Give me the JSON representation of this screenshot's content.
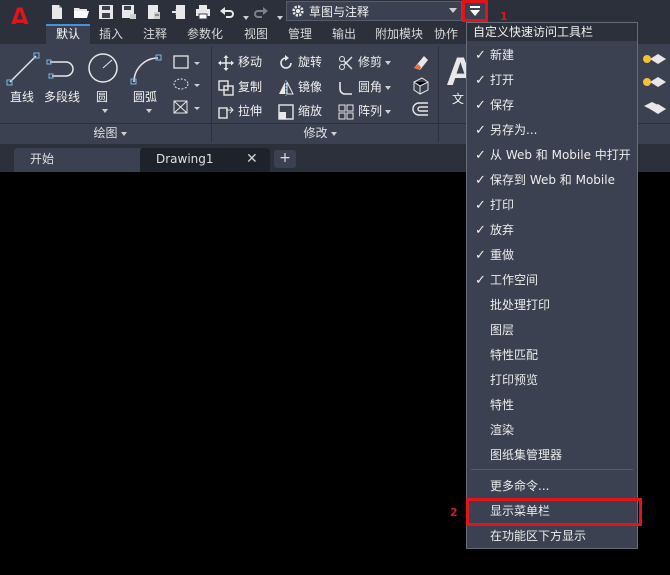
{
  "app": {
    "logo_letter": "A",
    "brand_color": "#e0151b"
  },
  "quick_access": {
    "icons": [
      "new-icon",
      "open-icon",
      "save-icon",
      "save-as-icon",
      "open-web-icon",
      "save-web-icon",
      "print-icon",
      "undo-icon",
      "redo-icon"
    ],
    "workspace": {
      "label": "草图与注释"
    }
  },
  "ribbon_tabs": [
    "默认",
    "插入",
    "注释",
    "参数化",
    "视图",
    "管理",
    "输出",
    "附加模块",
    "协作"
  ],
  "draw_panel": {
    "tools": [
      "直线",
      "多段线",
      "圆",
      "圆弧"
    ],
    "title": "绘图"
  },
  "modify_panel": {
    "rows": [
      [
        "移动",
        "旋转",
        "修剪"
      ],
      [
        "复制",
        "镜像",
        "圆角"
      ],
      [
        "拉伸",
        "缩放",
        "阵列"
      ]
    ],
    "title": "修改"
  },
  "annotation_partial": {
    "big_letter": "A",
    "label": "文"
  },
  "doc_tabs": [
    "开始",
    "Drawing1"
  ],
  "doc_tab_add": "+",
  "callouts": {
    "one": "1",
    "two": "2"
  },
  "menu": {
    "header": "自定义快速访问工具栏",
    "items": [
      {
        "label": "新建",
        "checked": true
      },
      {
        "label": "打开",
        "checked": true
      },
      {
        "label": "保存",
        "checked": true
      },
      {
        "label": "另存为...",
        "checked": true
      },
      {
        "label": "从 Web 和 Mobile 中打开",
        "checked": true
      },
      {
        "label": "保存到 Web 和 Mobile",
        "checked": true
      },
      {
        "label": "打印",
        "checked": true
      },
      {
        "label": "放弃",
        "checked": true
      },
      {
        "label": "重做",
        "checked": true
      },
      {
        "label": "工作空间",
        "checked": true
      },
      {
        "label": "批处理打印",
        "checked": false
      },
      {
        "label": "图层",
        "checked": false
      },
      {
        "label": "特性匹配",
        "checked": false
      },
      {
        "label": "打印预览",
        "checked": false
      },
      {
        "label": "特性",
        "checked": false
      },
      {
        "label": "渲染",
        "checked": false
      },
      {
        "label": "图纸集管理器",
        "checked": false
      }
    ],
    "more": "更多命令...",
    "show_menubar": "显示菜单栏",
    "below_ribbon": "在功能区下方显示",
    "check_glyph": "✓"
  }
}
